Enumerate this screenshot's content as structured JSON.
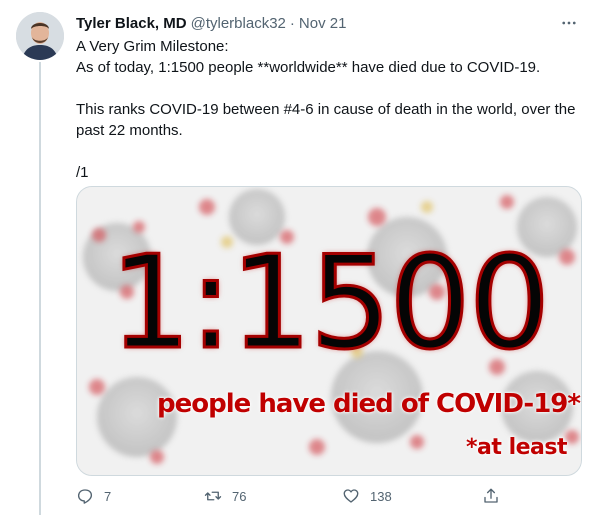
{
  "tweet": {
    "author_name": "Tyler Black, MD",
    "handle": "@tylerblack32",
    "separator": "·",
    "date": "Nov 21",
    "lines": [
      "A Very Grim Milestone:",
      "As of today, 1:1500 people **worldwide** have died due to COVID-19.",
      "",
      "This ranks COVID-19 between #4-6 in cause of death in the world, over the",
      "past 22 months.",
      "",
      "/1"
    ]
  },
  "image": {
    "ratio": "1:1500",
    "caption": "people have died of COVID-19*",
    "footnote": "*at least"
  },
  "actions": {
    "reply_count": "7",
    "retweet_count": "76",
    "like_count": "138"
  },
  "icons": {
    "more": "more-horizontal-icon",
    "reply": "reply-icon",
    "retweet": "retweet-icon",
    "like": "heart-icon",
    "share": "share-icon"
  },
  "colors": {
    "text": "#0f1419",
    "secondary": "#536471",
    "border": "#cfd9de",
    "image_red": "#c00000"
  }
}
